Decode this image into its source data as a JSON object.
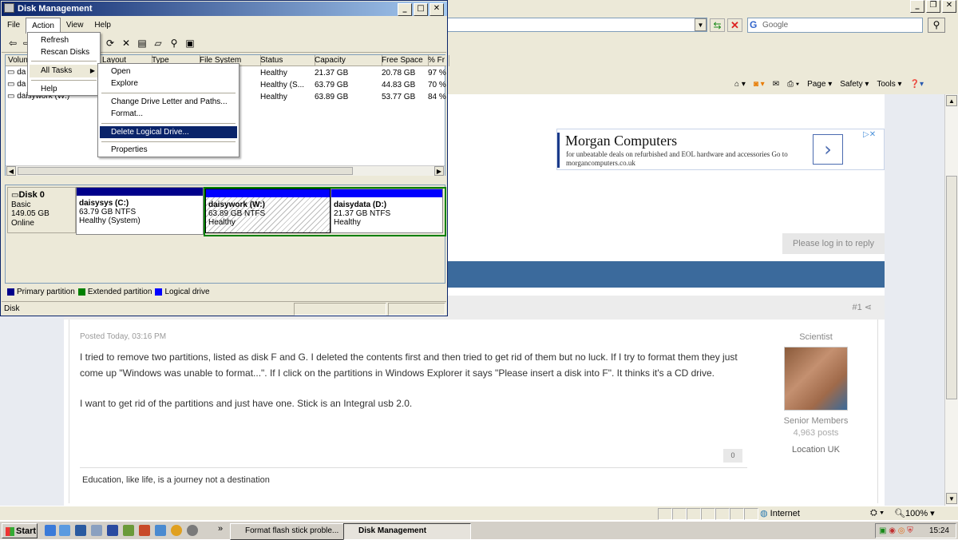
{
  "colors": {
    "primary_partition": "#00008b",
    "extended_partition": "#008000",
    "logical_drive": "#0000ff",
    "menu_highlight": "#0a246a",
    "title_bar": "#0a246a"
  },
  "browser": {
    "search_placeholder": "Google",
    "command_bar": [
      "Page ▾",
      "Safety ▾",
      "Tools ▾"
    ],
    "status": {
      "zone": "Internet",
      "zoom": "100%"
    }
  },
  "page": {
    "ad": {
      "title": "Morgan Computers",
      "description": "for unbeatable deals on refurbished and EOL hardware and accessories Go to morgancomputers.co.uk"
    },
    "reply_button": "Please log in to reply",
    "post": {
      "number": "#1",
      "date": "Posted Today, 03:16 PM",
      "text": "I tried to remove two partitions, listed as disk F and G. I deleted the contents first and then tried to get rid of them but no luck. If I try to format them they just come up \"Windows was unable to  format...\". If I click on the partitions in Windows Explorer it says \"Please insert a disk into F\". It thinks it's a CD drive.",
      "text2": "I want to  get rid of the partitions and just have one. Stick is an Integral usb 2.0.",
      "signature": "Education, like life, is a journey not a destination",
      "reputation": "0",
      "author": {
        "title": "Scientist",
        "group": "Senior Members",
        "posts": "4,963 posts",
        "location": "Location UK"
      }
    }
  },
  "disk_mgmt": {
    "title": "Disk Management",
    "menu": [
      "File",
      "Action",
      "View",
      "Help"
    ],
    "columns": [
      "Volum",
      "Layout",
      "Type",
      "File System",
      "Status",
      "Capacity",
      "Free Space",
      "% Fr"
    ],
    "rows": [
      {
        "volume": "da",
        "status": "Healthy",
        "capacity": "21.37 GB",
        "free": "20.78 GB",
        "pct": "97 %"
      },
      {
        "volume": "da",
        "status": "Healthy (S...",
        "capacity": "63.79 GB",
        "free": "44.83 GB",
        "pct": "70 %"
      },
      {
        "volume": "daisywork (W:)",
        "status": "Healthy",
        "capacity": "63.89 GB",
        "free": "53.77 GB",
        "pct": "84 %"
      }
    ],
    "disk": {
      "name": "Disk 0",
      "type": "Basic",
      "size": "149.05 GB",
      "state": "Online"
    },
    "partitions": [
      {
        "name": "daisysys  (C:)",
        "size": "63.79 GB NTFS",
        "status": "Healthy (System)",
        "kind": "primary"
      },
      {
        "name": "daisywork  (W:)",
        "size": "63.89 GB NTFS",
        "status": "Healthy",
        "kind": "logical-selected"
      },
      {
        "name": "daisydata  (D:)",
        "size": "21.37 GB NTFS",
        "status": "Healthy",
        "kind": "logical"
      }
    ],
    "legend": [
      "Primary partition",
      "Extended partition",
      "Logical drive"
    ],
    "status_text": "Disk",
    "action_menu": [
      "Refresh",
      "Rescan Disks",
      "All Tasks",
      "Help"
    ],
    "all_tasks_menu": [
      "Open",
      "Explore",
      "Change Drive Letter and Paths...",
      "Format...",
      "Delete Logical Drive...",
      "Properties"
    ]
  },
  "taskbar": {
    "start": "Start",
    "windows": [
      "Format flash stick proble...",
      "Disk Management"
    ],
    "clock": "15:24"
  }
}
